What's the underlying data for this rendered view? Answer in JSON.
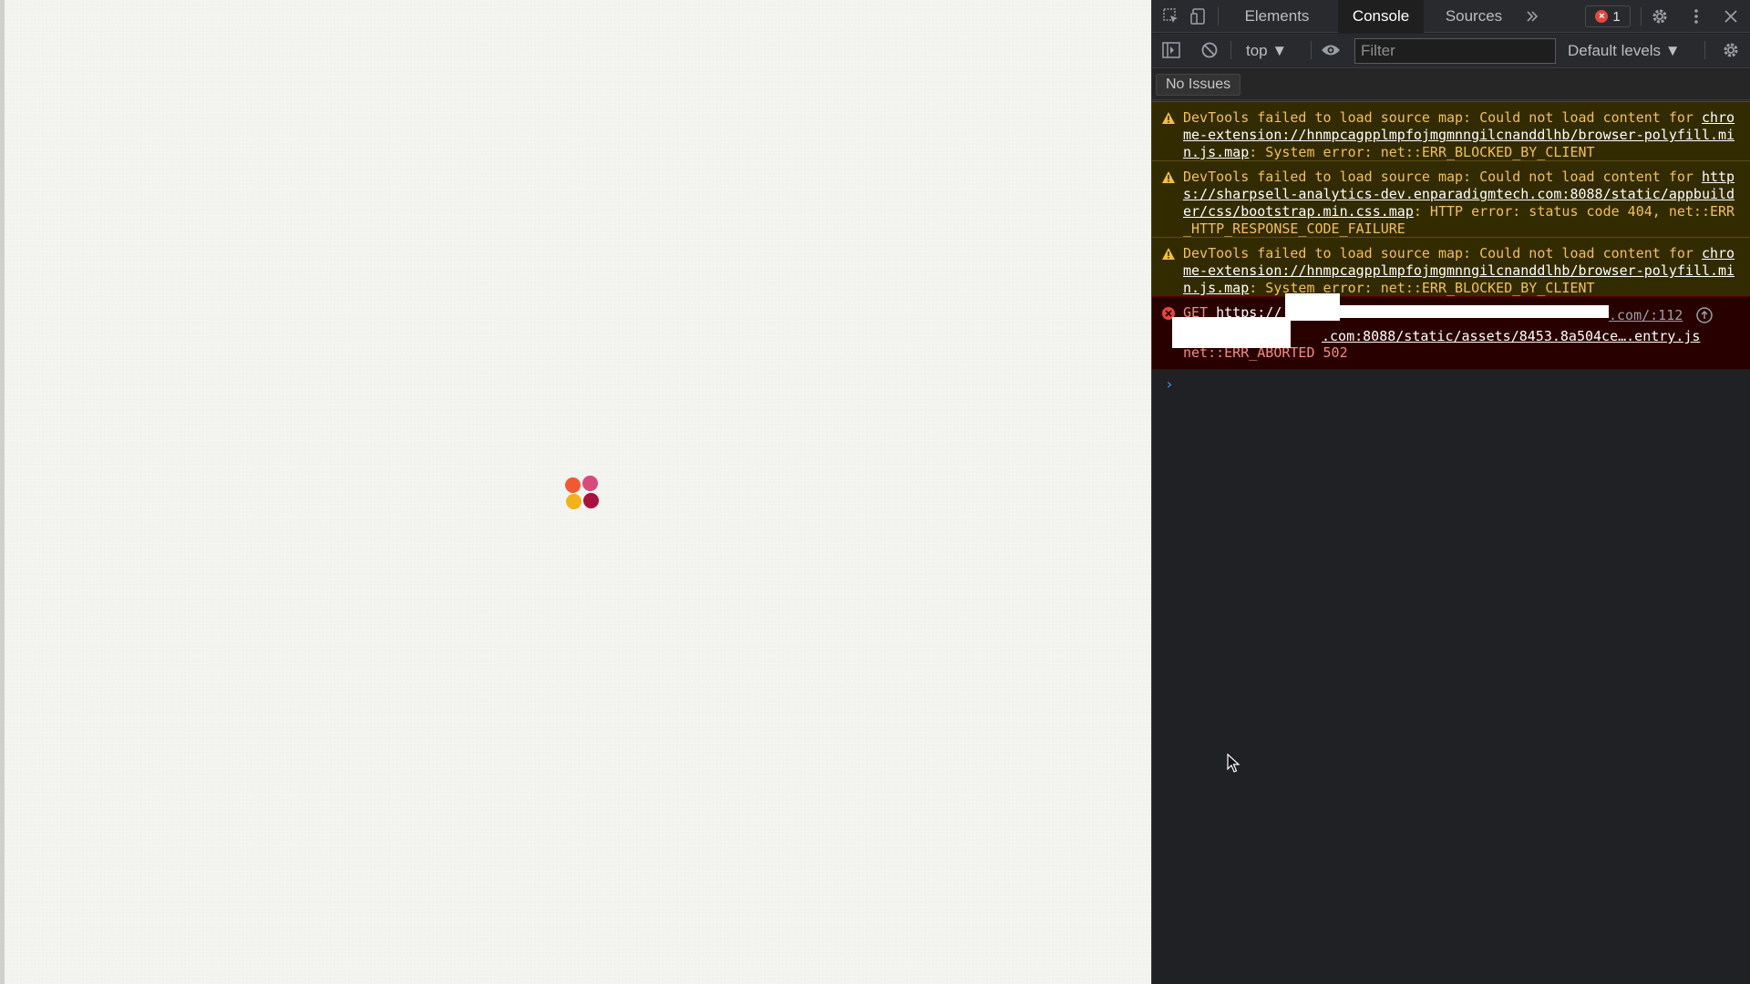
{
  "page": {
    "loader_colors": [
      "#ef5a34",
      "#d94a7c",
      "#f2b21b",
      "#a8123e"
    ]
  },
  "devtools": {
    "tabs": [
      {
        "label": "Elements"
      },
      {
        "label": "Console"
      },
      {
        "label": "Sources"
      }
    ],
    "active_tab": "Console",
    "more_tabs_icon": "chevron-double-right-icon",
    "error_count": "1",
    "toolbar": {
      "context": "top ▼",
      "filter_placeholder": "Filter",
      "levels": "Default levels ▼"
    },
    "issues_label": "No Issues",
    "messages": [
      {
        "level": "warning",
        "prefix": "DevTools failed to load source map: Could not load content for ",
        "link": "chrome-extension://hnmpcagpplmpfojmgmnngilcnanddlhb/browser-polyfill.min.js.map",
        "suffix": ": System error: net::ERR_BLOCKED_BY_CLIENT"
      },
      {
        "level": "warning",
        "prefix": "DevTools failed to load source map: Could not load content for ",
        "link": "https://sharpsell-analytics-dev.enparadigmtech.com:8088/static/appbuilder/css/bootstrap.min.css.map",
        "suffix": ": HTTP error: status code 404, net::ERR_HTTP_RESPONSE_CODE_FAILURE"
      },
      {
        "level": "warning",
        "prefix": "DevTools failed to load source map: Could not load content for ",
        "link": "chrome-extension://hnmpcagpplmpfojmgmnngilcnanddlhb/browser-polyfill.min.js.map",
        "suffix": ": System error: net::ERR_BLOCKED_BY_CLIENT"
      },
      {
        "level": "error",
        "method": "GET",
        "link_start": "https://",
        "link_tail": ".com/:112",
        "link2": ".com:8088/static/assets/8453.8a504ce….entry.js",
        "status": "net::ERR_ABORTED 502"
      }
    ],
    "prompt_symbol": "›"
  }
}
